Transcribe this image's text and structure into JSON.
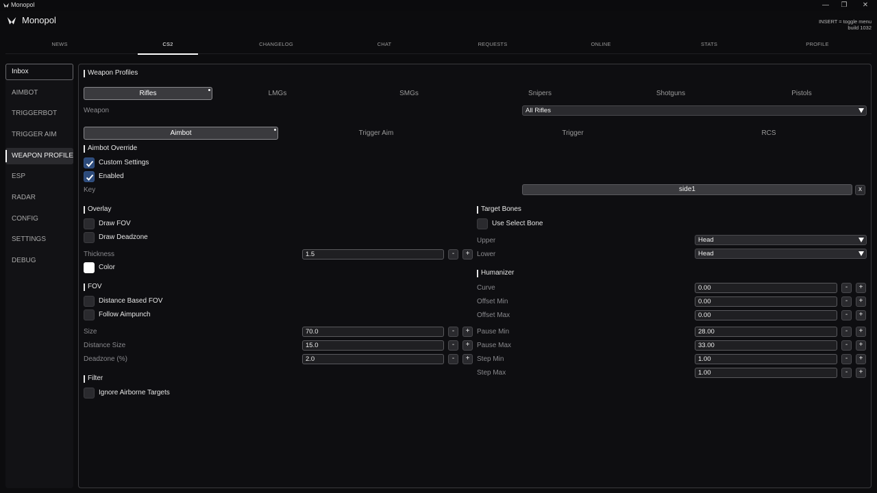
{
  "window": {
    "title": "Monopol",
    "app_name": "Monopol",
    "hint": "INSERT = toggle menu",
    "build": "build 1032"
  },
  "window_controls": {
    "minimize": "—",
    "restore": "❐",
    "close": "✕"
  },
  "tabs": [
    {
      "label": "NEWS"
    },
    {
      "label": "CS2"
    },
    {
      "label": "CHANGELOG"
    },
    {
      "label": "CHAT"
    },
    {
      "label": "REQUESTS"
    },
    {
      "label": "ONLINE"
    },
    {
      "label": "STATS"
    },
    {
      "label": "PROFILE"
    }
  ],
  "active_tab": "CS2",
  "sidebar": {
    "items": [
      {
        "label": "Inbox"
      },
      {
        "label": "AIMBOT"
      },
      {
        "label": "TRIGGERBOT"
      },
      {
        "label": "TRIGGER AIM"
      },
      {
        "label": "WEAPON PROFILES"
      },
      {
        "label": "ESP"
      },
      {
        "label": "RADAR"
      },
      {
        "label": "CONFIG"
      },
      {
        "label": "SETTINGS"
      },
      {
        "label": "DEBUG"
      }
    ],
    "active": "WEAPON PROFILES"
  },
  "main": {
    "title": "Weapon Profiles",
    "weapon_tabs": [
      {
        "label": "Rifles"
      },
      {
        "label": "LMGs"
      },
      {
        "label": "SMGs"
      },
      {
        "label": "Snipers"
      },
      {
        "label": "Shotguns"
      },
      {
        "label": "Pistols"
      }
    ],
    "active_weapon_tab": "Rifles",
    "weapon_label": "Weapon",
    "weapon_value": "All Rifles",
    "mode_tabs": [
      {
        "label": "Aimbot"
      },
      {
        "label": "Trigger Aim"
      },
      {
        "label": "Trigger"
      },
      {
        "label": "RCS"
      }
    ],
    "active_mode_tab": "Aimbot",
    "aimbot_override": {
      "title": "Aimbot Override",
      "custom_settings": {
        "label": "Custom Settings",
        "checked": true
      },
      "enabled": {
        "label": "Enabled",
        "checked": true
      },
      "key_label": "Key",
      "key_value": "side1",
      "key_clear": "x"
    },
    "overlay": {
      "title": "Overlay",
      "draw_fov": {
        "label": "Draw FOV",
        "checked": false
      },
      "draw_deadzone": {
        "label": "Draw Deadzone",
        "checked": false
      },
      "thickness_label": "Thickness",
      "thickness_value": "1.5",
      "color_label": "Color",
      "color_value": "#ffffff"
    },
    "fov": {
      "title": "FOV",
      "distance_based": {
        "label": "Distance Based FOV",
        "checked": false
      },
      "follow_aimpunch": {
        "label": "Follow Aimpunch",
        "checked": false
      },
      "size_label": "Size",
      "size_value": "70.0",
      "distance_size_label": "Distance Size",
      "distance_size_value": "15.0",
      "deadzone_label": "Deadzone (%)",
      "deadzone_value": "2.0"
    },
    "filter": {
      "title": "Filter",
      "ignore_airborne": {
        "label": "Ignore Airborne Targets",
        "checked": false
      }
    },
    "target_bones": {
      "title": "Target Bones",
      "use_select_bone": {
        "label": "Use Select Bone",
        "checked": false
      },
      "upper_label": "Upper",
      "upper_value": "Head",
      "lower_label": "Lower",
      "lower_value": "Head"
    },
    "humanizer": {
      "title": "Humanizer",
      "curve_label": "Curve",
      "curve_value": "0.00",
      "offset_min_label": "Offset Min",
      "offset_min_value": "0.00",
      "offset_max_label": "Offset Max",
      "offset_max_value": "0.00",
      "pause_min_label": "Pause Min",
      "pause_min_value": "28.00",
      "pause_max_label": "Pause Max",
      "pause_max_value": "33.00",
      "step_min_label": "Step Min",
      "step_min_value": "1.00",
      "step_max_label": "Step Max",
      "step_max_value": "1.00"
    },
    "stepper": {
      "minus": "-",
      "plus": "+"
    }
  }
}
